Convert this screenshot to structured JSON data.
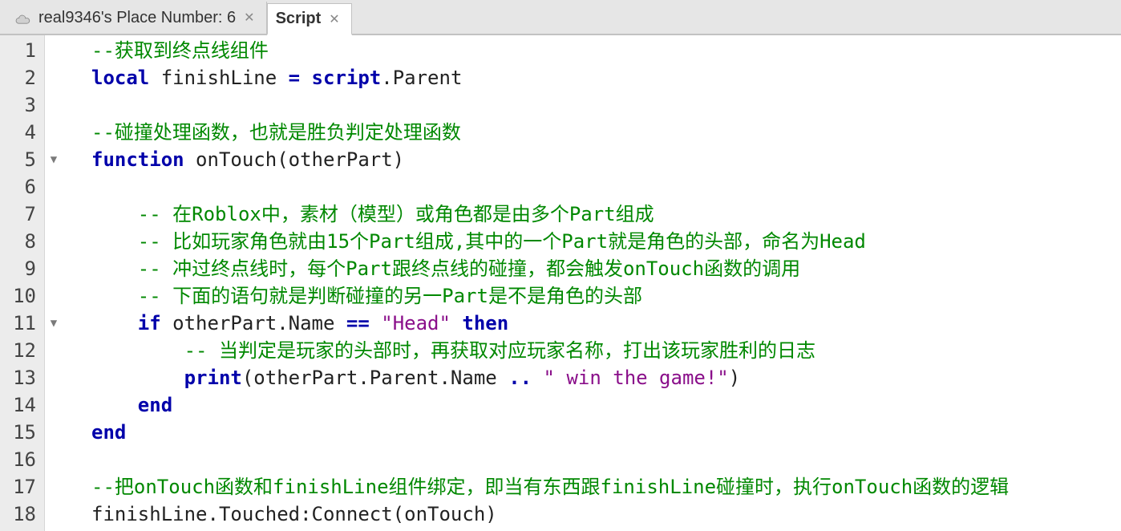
{
  "tabs": [
    {
      "label": "real9346's Place Number: 6",
      "active": false
    },
    {
      "label": "Script",
      "active": true
    }
  ],
  "fold_markers": {
    "5": true,
    "11": true
  },
  "line_numbers": [
    "1",
    "2",
    "3",
    "4",
    "5",
    "6",
    "7",
    "8",
    "9",
    "10",
    "11",
    "12",
    "13",
    "14",
    "15",
    "16",
    "17",
    "18"
  ],
  "code_lines": [
    [
      {
        "cls": "c-comment",
        "t": "--获取到终点线组件"
      }
    ],
    [
      {
        "cls": "c-keyword",
        "t": "local"
      },
      {
        "cls": "c-ident",
        "t": " finishLine "
      },
      {
        "cls": "c-op",
        "t": "="
      },
      {
        "cls": "c-ident",
        "t": " "
      },
      {
        "cls": "c-keyword",
        "t": "script"
      },
      {
        "cls": "c-ident",
        "t": ".Parent"
      }
    ],
    [
      {
        "cls": "c-ident",
        "t": ""
      }
    ],
    [
      {
        "cls": "c-comment",
        "t": "--碰撞处理函数，也就是胜负判定处理函数"
      }
    ],
    [
      {
        "cls": "c-keyword",
        "t": "function"
      },
      {
        "cls": "c-ident",
        "t": " onTouch(otherPart)"
      }
    ],
    [
      {
        "cls": "c-ident",
        "t": ""
      }
    ],
    [
      {
        "cls": "c-ident",
        "t": "    "
      },
      {
        "cls": "c-comment",
        "t": "-- 在Roblox中，素材（模型）或角色都是由多个Part组成"
      }
    ],
    [
      {
        "cls": "c-ident",
        "t": "    "
      },
      {
        "cls": "c-comment",
        "t": "-- 比如玩家角色就由15个Part组成,其中的一个Part就是角色的头部，命名为Head"
      }
    ],
    [
      {
        "cls": "c-ident",
        "t": "    "
      },
      {
        "cls": "c-comment",
        "t": "-- 冲过终点线时，每个Part跟终点线的碰撞，都会触发onTouch函数的调用"
      }
    ],
    [
      {
        "cls": "c-ident",
        "t": "    "
      },
      {
        "cls": "c-comment",
        "t": "-- 下面的语句就是判断碰撞的另一Part是不是角色的头部"
      }
    ],
    [
      {
        "cls": "c-ident",
        "t": "    "
      },
      {
        "cls": "c-keyword",
        "t": "if"
      },
      {
        "cls": "c-ident",
        "t": " otherPart.Name "
      },
      {
        "cls": "c-op",
        "t": "=="
      },
      {
        "cls": "c-ident",
        "t": " "
      },
      {
        "cls": "c-string",
        "t": "\"Head\""
      },
      {
        "cls": "c-ident",
        "t": " "
      },
      {
        "cls": "c-keyword",
        "t": "then"
      }
    ],
    [
      {
        "cls": "c-ident",
        "t": "        "
      },
      {
        "cls": "c-comment",
        "t": "-- 当判定是玩家的头部时，再获取对应玩家名称，打出该玩家胜利的日志"
      }
    ],
    [
      {
        "cls": "c-ident",
        "t": "        "
      },
      {
        "cls": "c-func",
        "t": "print"
      },
      {
        "cls": "c-ident",
        "t": "(otherPart.Parent.Name "
      },
      {
        "cls": "c-op",
        "t": ".."
      },
      {
        "cls": "c-ident",
        "t": " "
      },
      {
        "cls": "c-string",
        "t": "\" win the game!\""
      },
      {
        "cls": "c-ident",
        "t": ")"
      }
    ],
    [
      {
        "cls": "c-ident",
        "t": "    "
      },
      {
        "cls": "c-keyword",
        "t": "end"
      }
    ],
    [
      {
        "cls": "c-keyword",
        "t": "end"
      }
    ],
    [
      {
        "cls": "c-ident",
        "t": ""
      }
    ],
    [
      {
        "cls": "c-comment",
        "t": "--把onTouch函数和finishLine组件绑定，即当有东西跟finishLine碰撞时，执行onTouch函数的逻辑"
      }
    ],
    [
      {
        "cls": "c-ident",
        "t": "finishLine.Touched:Connect(onTouch)"
      }
    ]
  ]
}
